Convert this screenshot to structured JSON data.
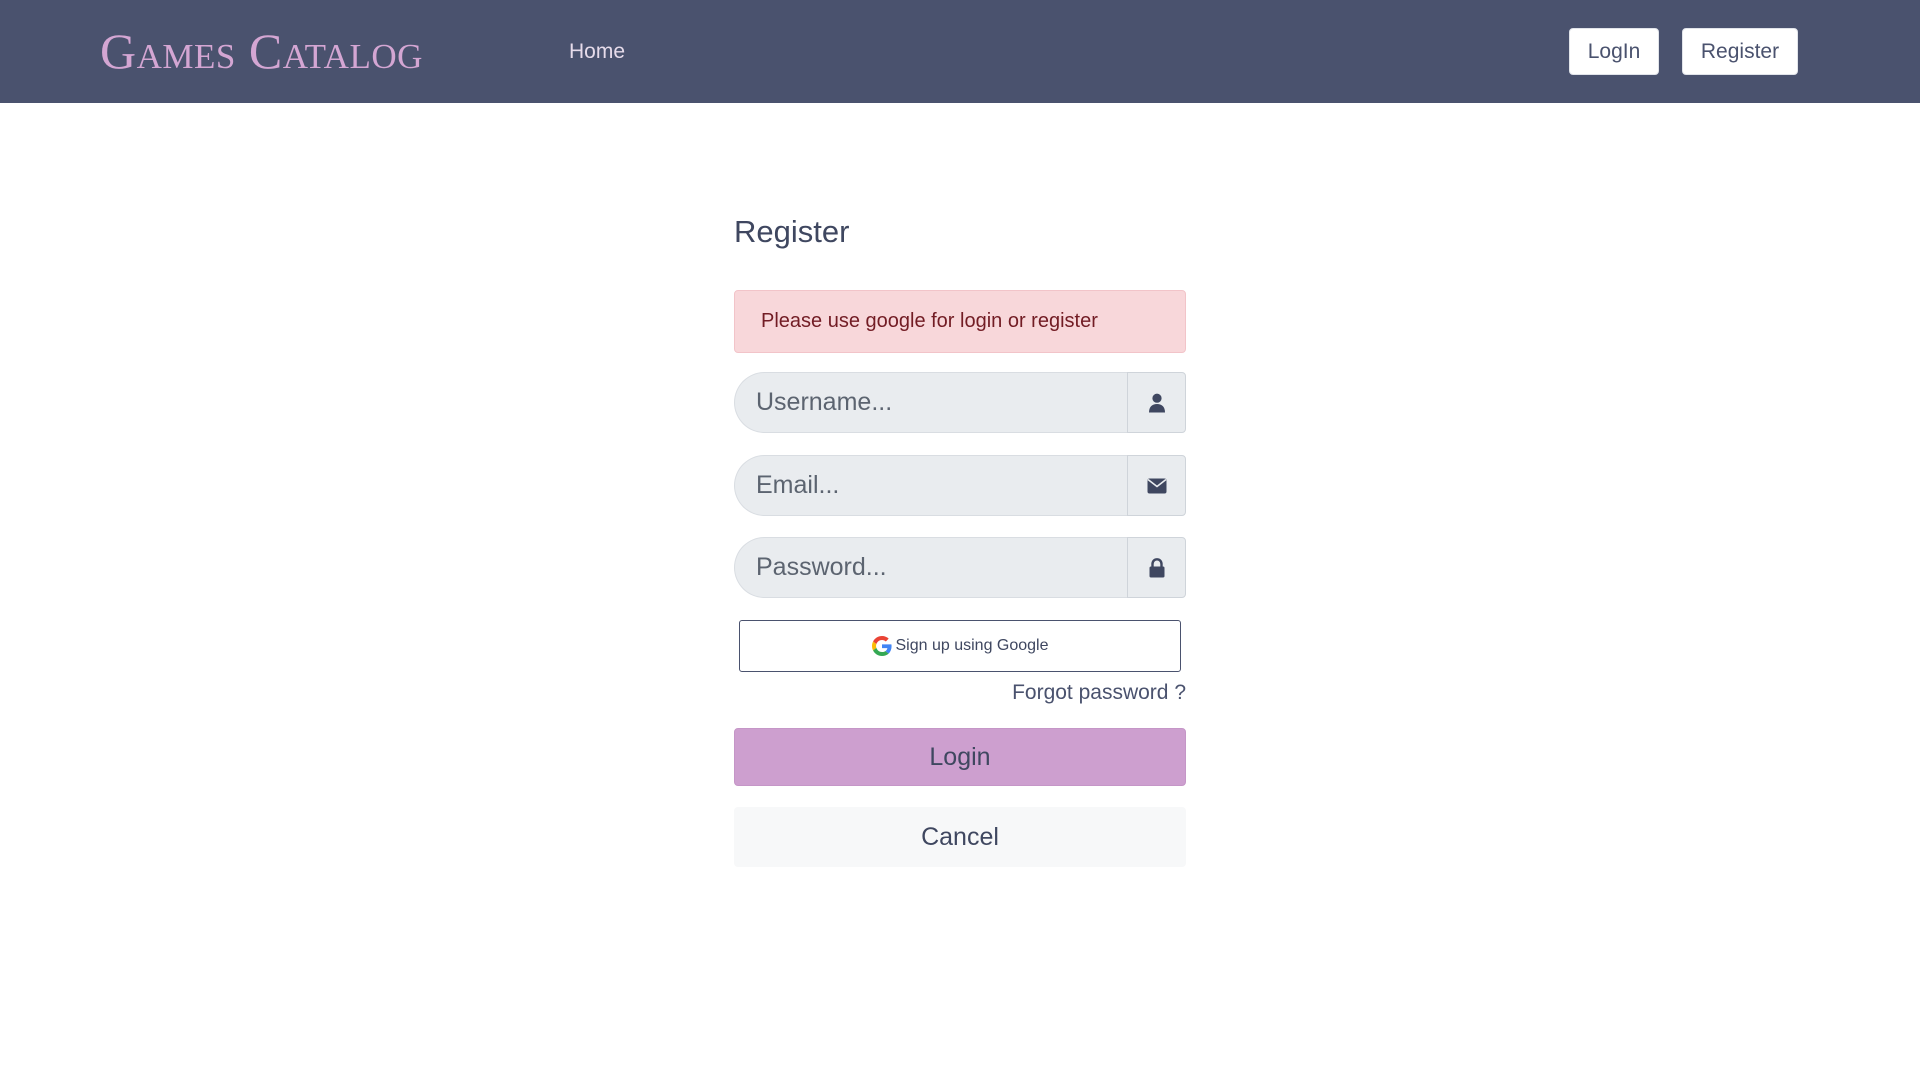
{
  "navbar": {
    "brand": "Games Catalog",
    "home_link": "Home",
    "login_button": "LogIn",
    "register_button": "Register"
  },
  "form": {
    "title": "Register",
    "alert": "Please use google for login or register",
    "username": {
      "placeholder": "Username...",
      "value": "",
      "icon": "user-icon"
    },
    "email": {
      "placeholder": "Email...",
      "value": "",
      "icon": "envelope-icon"
    },
    "password": {
      "placeholder": "Password...",
      "value": "",
      "icon": "lock-icon"
    },
    "google_button": "Sign up using Google",
    "forgot_password": "Forgot password ?",
    "login_button": "Login",
    "cancel_button": "Cancel"
  },
  "colors": {
    "navbar_bg": "#4a526e",
    "brand": "#d4a6d3",
    "primary_button": "#cd9fcf",
    "alert_bg": "#f8d7da",
    "alert_text": "#721c24"
  }
}
